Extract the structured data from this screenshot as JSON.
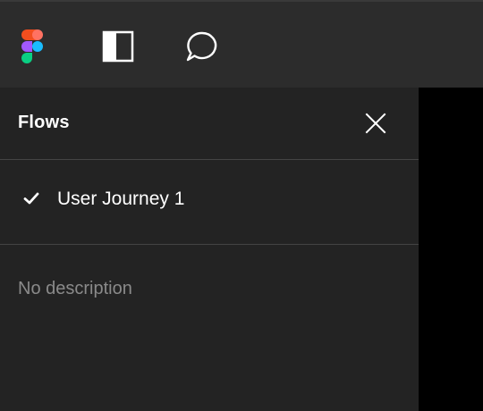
{
  "toolbar": {
    "logo_icon": "figma-logo-icon",
    "panel_toggle_icon": "sidebar-panel-icon",
    "comment_icon": "comment-bubble-icon"
  },
  "flows_panel": {
    "title": "Flows",
    "close_icon": "close-icon",
    "items": [
      {
        "label": "User Journey 1",
        "selected": true,
        "icon": "checkmark-icon"
      }
    ],
    "description": "No description"
  },
  "colors": {
    "topbar_bg": "#2c2c2c",
    "panel_bg": "#232323",
    "canvas_bg": "#000000",
    "divider": "#444444",
    "text_primary": "#ffffff",
    "text_muted": "#8a8a8a",
    "logo_red": "#f24e1e",
    "logo_orange": "#ff7262",
    "logo_purple": "#a259ff",
    "logo_blue": "#1abcfe",
    "logo_green": "#0acf83"
  }
}
